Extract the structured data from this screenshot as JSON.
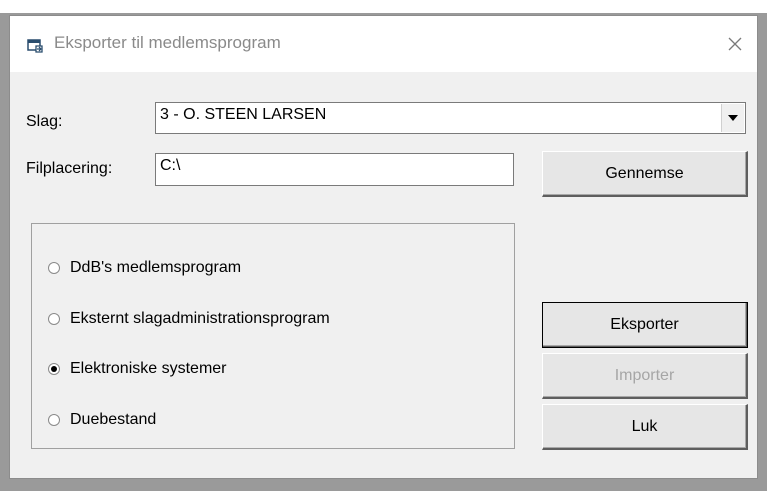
{
  "window": {
    "title": "Eksporter til medlemsprogram",
    "close_symbol": "✕"
  },
  "form": {
    "slag_label": "Slag:",
    "slag_value": "3 - O. STEEN LARSEN",
    "filplacering_label": "Filplacering:",
    "filplacering_value": "C:\\"
  },
  "buttons": {
    "browse": "Gennemse",
    "export": "Eksporter",
    "import": "Importer",
    "close": "Luk"
  },
  "options": [
    {
      "label": "DdB's medlemsprogram",
      "selected": false
    },
    {
      "label": "Eksternt slagadministrationsprogram",
      "selected": false
    },
    {
      "label": "Elektroniske systemer",
      "selected": true
    },
    {
      "label": "Duebestand",
      "selected": false
    }
  ],
  "icons": {
    "app": "export-window-icon",
    "dropdown": "chevron-down-icon"
  }
}
